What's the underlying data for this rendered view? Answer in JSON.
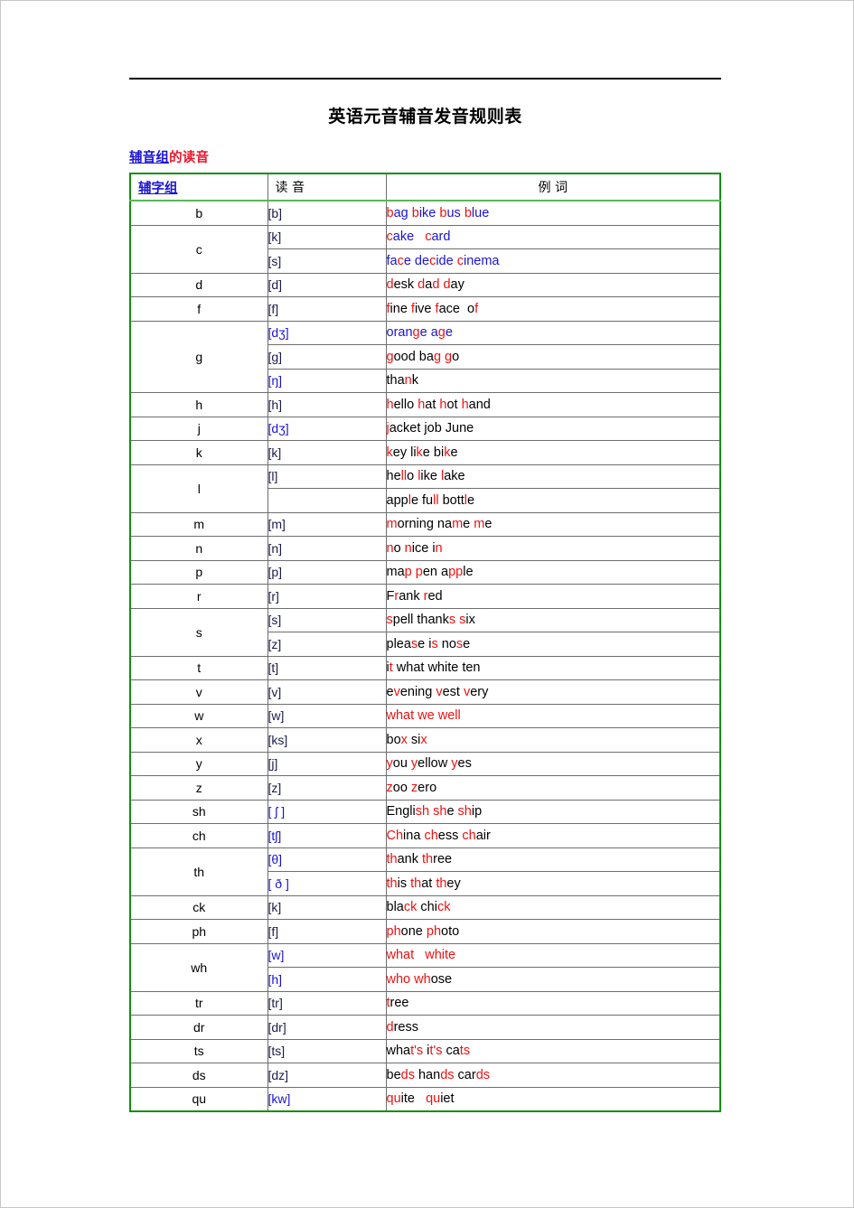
{
  "document": {
    "title": "英语元音辅音发音规则表",
    "subtitle_link": "辅音组",
    "subtitle_rest": "的读音"
  },
  "table": {
    "headers": {
      "col1": "辅字组",
      "col2": "读 音",
      "col3": "例    词"
    },
    "rows": [
      {
        "letter": "b",
        "letter_rowspan": 1,
        "phonetic": "[b]",
        "phonetic_blue": false,
        "words_base": "blue",
        "words": "bag bike bus blue"
      },
      {
        "letter": "c",
        "letter_rowspan": 2,
        "phonetic": "[k]",
        "phonetic_blue": false,
        "words_base": "blue",
        "words": "cake   card"
      },
      {
        "letter": "",
        "letter_rowspan": 0,
        "phonetic": "[s]",
        "phonetic_blue": false,
        "words_base": "blue",
        "words": "face decide cinema"
      },
      {
        "letter": "d",
        "letter_rowspan": 1,
        "phonetic": "[d]",
        "phonetic_blue": false,
        "words_base": "black",
        "words": "desk dad day"
      },
      {
        "letter": "f",
        "letter_rowspan": 1,
        "phonetic": "[f]",
        "phonetic_blue": false,
        "words_base": "black",
        "words": "fine five face of"
      },
      {
        "letter": "g",
        "letter_rowspan": 3,
        "phonetic": "[dʒ]",
        "phonetic_blue": true,
        "words_base": "blue",
        "words": "orange age"
      },
      {
        "letter": "",
        "letter_rowspan": 0,
        "phonetic": "[g]",
        "phonetic_blue": false,
        "words_base": "black",
        "words": "good bag go"
      },
      {
        "letter": "",
        "letter_rowspan": 0,
        "phonetic": "[ŋ]",
        "phonetic_blue": true,
        "words_base": "black",
        "words": "thank"
      },
      {
        "letter": "h",
        "letter_rowspan": 1,
        "phonetic": "[h]",
        "phonetic_blue": false,
        "words_base": "black",
        "words": "hello hat hot hand"
      },
      {
        "letter": "j",
        "letter_rowspan": 1,
        "phonetic": "[dʒ]",
        "phonetic_blue": true,
        "words_base": "black",
        "words": "jacket job June"
      },
      {
        "letter": "k",
        "letter_rowspan": 1,
        "phonetic": "[k]",
        "phonetic_blue": false,
        "words_base": "black",
        "words": "key like bike"
      },
      {
        "letter": "l",
        "letter_rowspan": 2,
        "phonetic": "[l]",
        "phonetic_blue": false,
        "words_base": "black",
        "words": "hello like lake"
      },
      {
        "letter": "",
        "letter_rowspan": 0,
        "phonetic": "",
        "phonetic_blue": false,
        "words_base": "black",
        "words": "apple full bottle"
      },
      {
        "letter": "m",
        "letter_rowspan": 1,
        "phonetic": "[m]",
        "phonetic_blue": false,
        "words_base": "black",
        "words": "morning name me"
      },
      {
        "letter": "n",
        "letter_rowspan": 1,
        "phonetic": "[n]",
        "phonetic_blue": false,
        "words_base": "black",
        "words": "no nice in"
      },
      {
        "letter": "p",
        "letter_rowspan": 1,
        "phonetic": "[p]",
        "phonetic_blue": false,
        "words_base": "black",
        "words": "map pen apple"
      },
      {
        "letter": "r",
        "letter_rowspan": 1,
        "phonetic": "[r]",
        "phonetic_blue": false,
        "words_base": "black",
        "words": "Frank red"
      },
      {
        "letter": "s",
        "letter_rowspan": 2,
        "phonetic": "[s]",
        "phonetic_blue": false,
        "words_base": "black",
        "words": "spell thanks six"
      },
      {
        "letter": "",
        "letter_rowspan": 0,
        "phonetic": "[z]",
        "phonetic_blue": false,
        "words_base": "black",
        "words": "please is nose"
      },
      {
        "letter": "t",
        "letter_rowspan": 1,
        "phonetic": "[t]",
        "phonetic_blue": false,
        "words_base": "black",
        "words": "it what white ten"
      },
      {
        "letter": "v",
        "letter_rowspan": 1,
        "phonetic": "[v]",
        "phonetic_blue": false,
        "words_base": "black",
        "words": "evening vest very"
      },
      {
        "letter": "w",
        "letter_rowspan": 1,
        "phonetic": "[w]",
        "phonetic_blue": false,
        "words_base": "black",
        "words": "what we well"
      },
      {
        "letter": "x",
        "letter_rowspan": 1,
        "phonetic": "[ks]",
        "phonetic_blue": false,
        "words_base": "black",
        "words": "box six"
      },
      {
        "letter": "y",
        "letter_rowspan": 1,
        "phonetic": "[j]",
        "phonetic_blue": false,
        "words_base": "black",
        "words": "you yellow yes"
      },
      {
        "letter": "z",
        "letter_rowspan": 1,
        "phonetic": "[z]",
        "phonetic_blue": false,
        "words_base": "black",
        "words": "zoo zero"
      },
      {
        "letter": "sh",
        "letter_rowspan": 1,
        "phonetic": "[ ʃ ]",
        "phonetic_blue": true,
        "words_base": "black",
        "words": "English she ship"
      },
      {
        "letter": "ch",
        "letter_rowspan": 1,
        "phonetic": "[tʃ]",
        "phonetic_blue": true,
        "words_base": "black",
        "words": "China chess chair"
      },
      {
        "letter": "th",
        "letter_rowspan": 2,
        "phonetic": "[θ]",
        "phonetic_blue": true,
        "words_base": "black",
        "words": "thank three"
      },
      {
        "letter": "",
        "letter_rowspan": 0,
        "phonetic": "[ ð ]",
        "phonetic_blue": true,
        "words_base": "black",
        "words": "this that they"
      },
      {
        "letter": "ck",
        "letter_rowspan": 1,
        "phonetic": "[k]",
        "phonetic_blue": false,
        "words_base": "black",
        "words": "black chick"
      },
      {
        "letter": "ph",
        "letter_rowspan": 1,
        "phonetic": "[f]",
        "phonetic_blue": false,
        "words_base": "black",
        "words": "phone photo"
      },
      {
        "letter": "wh",
        "letter_rowspan": 2,
        "phonetic": "[w]",
        "phonetic_blue": true,
        "words_base": "black",
        "words": "what   white"
      },
      {
        "letter": "",
        "letter_rowspan": 0,
        "phonetic": "[h]",
        "phonetic_blue": true,
        "words_base": "black",
        "words": "who whose"
      },
      {
        "letter": "tr",
        "letter_rowspan": 1,
        "phonetic": "[tr]",
        "phonetic_blue": false,
        "words_base": "black",
        "words": "tree"
      },
      {
        "letter": "dr",
        "letter_rowspan": 1,
        "phonetic": "[dr]",
        "phonetic_blue": false,
        "words_base": "black",
        "words": "dress"
      },
      {
        "letter": "ts",
        "letter_rowspan": 1,
        "phonetic": "[ts]",
        "phonetic_blue": false,
        "words_base": "black",
        "words": "what's it's cats"
      },
      {
        "letter": "ds",
        "letter_rowspan": 1,
        "phonetic": "[dz]",
        "phonetic_blue": false,
        "words_base": "black",
        "words": "beds hands cards"
      },
      {
        "letter": "qu",
        "letter_rowspan": 1,
        "phonetic": "[kw]",
        "phonetic_blue": true,
        "words_base": "black",
        "words": "quite   quiet"
      }
    ],
    "word_highlights": [
      [
        [
          "b",
          "r"
        ],
        [
          "ag",
          "bl"
        ],
        [
          " ",
          "bl"
        ],
        [
          "b",
          "r"
        ],
        [
          "ike",
          "bl"
        ],
        [
          " ",
          "bl"
        ],
        [
          "b",
          "r"
        ],
        [
          "us",
          "bl"
        ],
        [
          " ",
          "bl"
        ],
        [
          "b",
          "r"
        ],
        [
          "lue",
          "bl"
        ]
      ],
      [
        [
          "c",
          "r"
        ],
        [
          "ake",
          "bl"
        ],
        [
          "   ",
          "bl"
        ],
        [
          "c",
          "r"
        ],
        [
          "ard",
          "bl"
        ]
      ],
      [
        [
          "fa",
          "bl"
        ],
        [
          "c",
          "r"
        ],
        [
          "e de",
          "bl"
        ],
        [
          "c",
          "r"
        ],
        [
          "ide ",
          "bl"
        ],
        [
          "c",
          "r"
        ],
        [
          "inema",
          "bl"
        ]
      ],
      [
        [
          "d",
          "r"
        ],
        [
          "esk ",
          "k"
        ],
        [
          "d",
          "r"
        ],
        [
          "a",
          "k"
        ],
        [
          "d",
          "r"
        ],
        [
          " ",
          "k"
        ],
        [
          "d",
          "r"
        ],
        [
          "ay",
          "k"
        ]
      ],
      [
        [
          "f",
          "r"
        ],
        [
          "ine ",
          "k"
        ],
        [
          "f",
          "r"
        ],
        [
          "ive ",
          "k"
        ],
        [
          "f",
          "r"
        ],
        [
          "ace  o",
          "k"
        ],
        [
          "f",
          "r"
        ]
      ],
      [
        [
          "oran",
          "bl"
        ],
        [
          "g",
          "r"
        ],
        [
          "e a",
          "bl"
        ],
        [
          "g",
          "r"
        ],
        [
          "e",
          "bl"
        ]
      ],
      [
        [
          "g",
          "r"
        ],
        [
          "ood ba",
          "k"
        ],
        [
          "g",
          "r"
        ],
        [
          " ",
          "k"
        ],
        [
          "g",
          "r"
        ],
        [
          "o",
          "k"
        ]
      ],
      [
        [
          "tha",
          "k"
        ],
        [
          "n",
          "r"
        ],
        [
          "k",
          "k"
        ]
      ],
      [
        [
          "h",
          "r"
        ],
        [
          "ello ",
          "k"
        ],
        [
          "h",
          "r"
        ],
        [
          "at ",
          "k"
        ],
        [
          "h",
          "r"
        ],
        [
          "ot ",
          "k"
        ],
        [
          "h",
          "r"
        ],
        [
          "and",
          "k"
        ]
      ],
      [
        [
          "j",
          "r"
        ],
        [
          "acket job June",
          "k"
        ]
      ],
      [
        [
          "k",
          "r"
        ],
        [
          "ey li",
          "k"
        ],
        [
          "k",
          "r"
        ],
        [
          "e bi",
          "k"
        ],
        [
          "k",
          "r"
        ],
        [
          "e",
          "k"
        ]
      ],
      [
        [
          "he",
          "k"
        ],
        [
          "ll",
          "r"
        ],
        [
          "o ",
          "k"
        ],
        [
          "l",
          "r"
        ],
        [
          "ike ",
          "k"
        ],
        [
          "l",
          "r"
        ],
        [
          "ake",
          "k"
        ]
      ],
      [
        [
          "app",
          "k"
        ],
        [
          "l",
          "r"
        ],
        [
          "e fu",
          "k"
        ],
        [
          "ll",
          "r"
        ],
        [
          " bott",
          "k"
        ],
        [
          "l",
          "r"
        ],
        [
          "e",
          "k"
        ]
      ],
      [
        [
          "m",
          "r"
        ],
        [
          "orning na",
          "k"
        ],
        [
          "m",
          "r"
        ],
        [
          "e ",
          "k"
        ],
        [
          "m",
          "r"
        ],
        [
          "e",
          "k"
        ]
      ],
      [
        [
          "n",
          "r"
        ],
        [
          "o ",
          "k"
        ],
        [
          "n",
          "r"
        ],
        [
          "ice i",
          "k"
        ],
        [
          "n",
          "r"
        ]
      ],
      [
        [
          "ma",
          "k"
        ],
        [
          "p",
          "r"
        ],
        [
          " ",
          "k"
        ],
        [
          "p",
          "r"
        ],
        [
          "en a",
          "k"
        ],
        [
          "pp",
          "r"
        ],
        [
          "le",
          "k"
        ]
      ],
      [
        [
          "F",
          "k"
        ],
        [
          "r",
          "r"
        ],
        [
          "ank ",
          "k"
        ],
        [
          "r",
          "r"
        ],
        [
          "ed",
          "k"
        ]
      ],
      [
        [
          "s",
          "r"
        ],
        [
          "pell thank",
          "k"
        ],
        [
          "s",
          "r"
        ],
        [
          " ",
          "k"
        ],
        [
          "s",
          "r"
        ],
        [
          "ix",
          "k"
        ]
      ],
      [
        [
          "plea",
          "k"
        ],
        [
          "s",
          "r"
        ],
        [
          "e i",
          "k"
        ],
        [
          "s",
          "r"
        ],
        [
          " no",
          "k"
        ],
        [
          "s",
          "r"
        ],
        [
          "e",
          "k"
        ]
      ],
      [
        [
          "i",
          "k"
        ],
        [
          "t",
          "r"
        ],
        [
          " what white ten",
          "k"
        ]
      ],
      [
        [
          "e",
          "k"
        ],
        [
          "v",
          "r"
        ],
        [
          "ening ",
          "k"
        ],
        [
          "v",
          "r"
        ],
        [
          "est ",
          "k"
        ],
        [
          "v",
          "r"
        ],
        [
          "ery",
          "k"
        ]
      ],
      [
        [
          "w",
          "r"
        ],
        [
          "hat ",
          "r"
        ],
        [
          "w",
          "r"
        ],
        [
          "e ",
          "r"
        ],
        [
          "w",
          "r"
        ],
        [
          "ell",
          "r"
        ]
      ],
      [
        [
          "bo",
          "k"
        ],
        [
          "x",
          "r"
        ],
        [
          " si",
          "k"
        ],
        [
          "x",
          "r"
        ]
      ],
      [
        [
          "y",
          "r"
        ],
        [
          "ou ",
          "k"
        ],
        [
          "y",
          "r"
        ],
        [
          "ellow ",
          "k"
        ],
        [
          "y",
          "r"
        ],
        [
          "es",
          "k"
        ]
      ],
      [
        [
          "z",
          "r"
        ],
        [
          "oo ",
          "k"
        ],
        [
          "z",
          "r"
        ],
        [
          "ero",
          "k"
        ]
      ],
      [
        [
          "Engli",
          "k"
        ],
        [
          "sh",
          "r"
        ],
        [
          " ",
          "k"
        ],
        [
          "sh",
          "r"
        ],
        [
          "e ",
          "k"
        ],
        [
          "sh",
          "r"
        ],
        [
          "ip",
          "k"
        ]
      ],
      [
        [
          "Ch",
          "r"
        ],
        [
          "ina ",
          "k"
        ],
        [
          "ch",
          "r"
        ],
        [
          "ess ",
          "k"
        ],
        [
          "ch",
          "r"
        ],
        [
          "air",
          "k"
        ]
      ],
      [
        [
          "th",
          "r"
        ],
        [
          "ank ",
          "k"
        ],
        [
          "th",
          "r"
        ],
        [
          "ree",
          "k"
        ]
      ],
      [
        [
          "th",
          "r"
        ],
        [
          "is ",
          "k"
        ],
        [
          "th",
          "r"
        ],
        [
          "at ",
          "k"
        ],
        [
          "th",
          "r"
        ],
        [
          "ey",
          "k"
        ]
      ],
      [
        [
          "bla",
          "k"
        ],
        [
          "ck",
          "r"
        ],
        [
          " ",
          "k"
        ],
        [
          "ch",
          "k"
        ],
        [
          "i",
          "k"
        ],
        [
          "ck",
          "r"
        ]
      ],
      [
        [
          "ph",
          "r"
        ],
        [
          "one ",
          "k"
        ],
        [
          "ph",
          "r"
        ],
        [
          "oto",
          "k"
        ]
      ],
      [
        [
          "wh",
          "r"
        ],
        [
          "at",
          "r"
        ],
        [
          "   ",
          "k"
        ],
        [
          "wh",
          "r"
        ],
        [
          "ite",
          "r"
        ]
      ],
      [
        [
          "wh",
          "r"
        ],
        [
          "o ",
          "r"
        ],
        [
          "wh",
          "r"
        ],
        [
          "ose",
          "k"
        ]
      ],
      [
        [
          "t",
          "r"
        ],
        [
          "ree",
          "k"
        ]
      ],
      [
        [
          "d",
          "r"
        ],
        [
          "ress",
          "k"
        ]
      ],
      [
        [
          "wha",
          "k"
        ],
        [
          "t's",
          "r"
        ],
        [
          " i",
          "k"
        ],
        [
          "t's",
          "r"
        ],
        [
          " ca",
          "k"
        ],
        [
          "ts",
          "r"
        ]
      ],
      [
        [
          "be",
          "k"
        ],
        [
          "ds",
          "r"
        ],
        [
          " han",
          "k"
        ],
        [
          "ds",
          "r"
        ],
        [
          " car",
          "k"
        ],
        [
          "ds",
          "r"
        ]
      ],
      [
        [
          "qu",
          "r"
        ],
        [
          "ite",
          "k"
        ],
        [
          "   ",
          "k"
        ],
        [
          "qu",
          "r"
        ],
        [
          "iet",
          "k"
        ]
      ]
    ]
  },
  "colors": {
    "red": "#f01010",
    "blue": "#1a13d2",
    "black": "#000000",
    "table_border_green": "#128e12",
    "cell_border": "#6e6e6e"
  }
}
